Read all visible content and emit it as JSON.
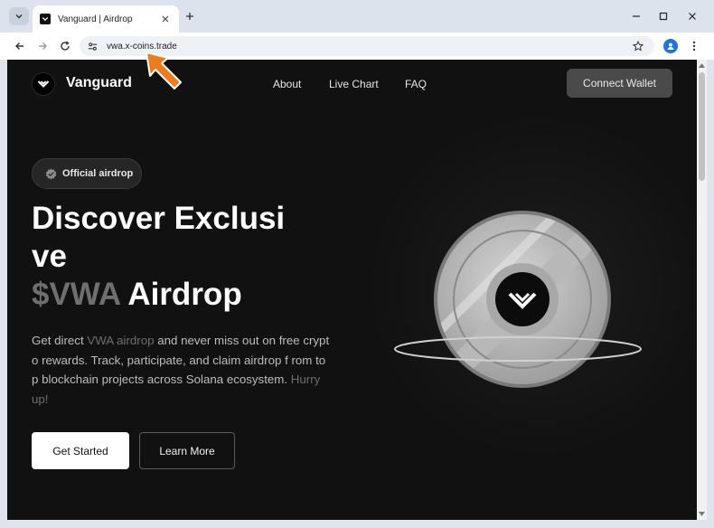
{
  "browser": {
    "tab_title": "Vanguard | Airdrop",
    "url": "vwa.x-coins.trade"
  },
  "site": {
    "brand": "Vanguard",
    "nav": [
      "About",
      "Live Chart",
      "FAQ"
    ],
    "connect_label": "Connect Wallet",
    "badge": "Official airdrop",
    "headline_line1": "Discover Exclusi",
    "headline_line2": "ve",
    "headline_ticker": "$VWA",
    "headline_rest": " Airdrop",
    "desc_part1": "Get direct ",
    "desc_highlight1": "VWA airdrop",
    "desc_part2": " and never miss out on free crypto rewards. Track, participate, and claim airdrop f rom top blockchain projects across Solana ecosystem. ",
    "desc_highlight2": "Hurry up!",
    "get_started": "Get Started",
    "learn_more": "Learn More"
  },
  "colors": {
    "page_bg": "#111111",
    "accent_gray": "#6f6f6f",
    "cursor": "#f07b1a"
  }
}
